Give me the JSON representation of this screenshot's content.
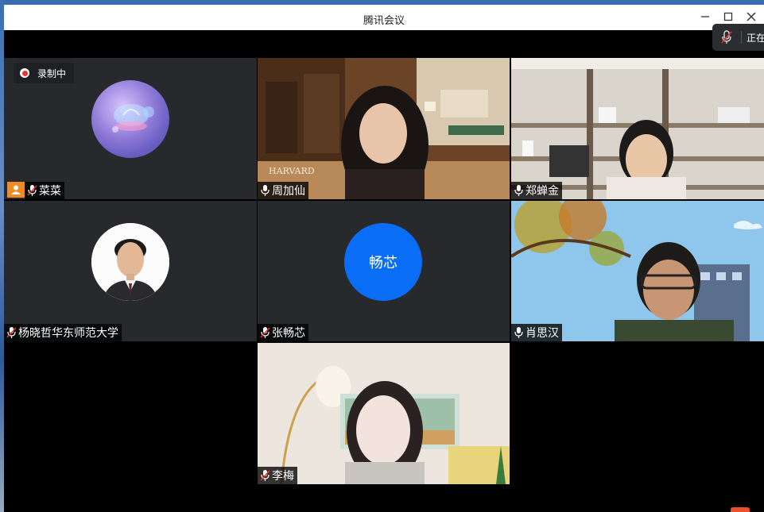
{
  "window": {
    "title": "腾讯会议",
    "minimize_icon": "minimize-icon",
    "maximize_icon": "maximize-icon",
    "close_icon": "close-icon"
  },
  "mic_status": {
    "icon": "mic-muted-icon",
    "text": "正在"
  },
  "recording": {
    "label": "录制中",
    "icon": "record-dot-icon"
  },
  "participants": [
    {
      "name": "菜菜",
      "mic": "muted",
      "video": "avatar-image",
      "host_icon": "person-icon"
    },
    {
      "name": "周加仙",
      "mic": "on",
      "video": "camera"
    },
    {
      "name": "郑蝉金",
      "mic": "on",
      "video": "camera"
    },
    {
      "name": "杨晓哲华东师范大学",
      "mic": "muted",
      "video": "avatar-photo"
    },
    {
      "name": "张畅芯",
      "mic": "muted",
      "video": "text-avatar",
      "avatar_text": "畅芯"
    },
    {
      "name": "肖思汉",
      "mic": "on",
      "video": "camera",
      "speaking": true
    },
    {
      "name": "李梅",
      "mic": "muted",
      "video": "camera"
    }
  ],
  "colors": {
    "tile_bg": "#27292d",
    "text_avatar_bg": "#0a6df5",
    "recording_red": "#e8352e",
    "speaking_border": "#3cc86a"
  }
}
